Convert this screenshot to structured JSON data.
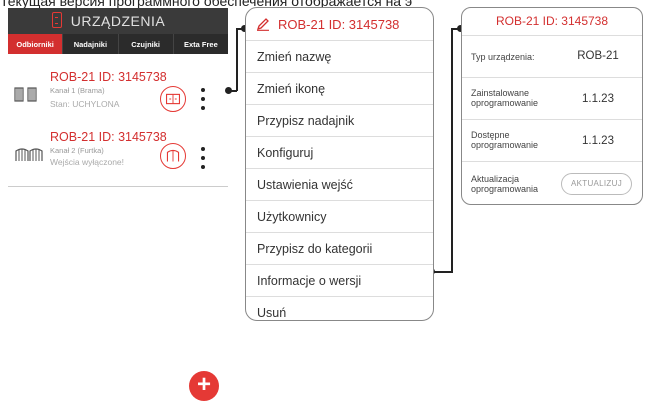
{
  "caption": "Текущая версия программного обеспечения отображается на э",
  "app": {
    "title": "URZĄDZENIA",
    "tabs": [
      "Odbiorniki",
      "Nadajniki",
      "Czujniki",
      "Exta Free"
    ],
    "devices": [
      {
        "title": "ROB-21 ID: 3145738",
        "channel": "Kanał 1 (Brama)",
        "status": "Stan: UCHYLONA",
        "icon": "sliding-gate-icon",
        "action_icon": "sliding-gate-round-icon"
      },
      {
        "title": "ROB-21 ID: 3145738",
        "channel": "Kanał 2 (Furtka)",
        "status": "Wejścia wyłączone!",
        "icon": "double-gate-icon",
        "action_icon": "double-gate-round-icon"
      }
    ],
    "fab_label": "+"
  },
  "menu": {
    "title": "ROB-21 ID: 3145738",
    "items": [
      "Zmień nazwę",
      "Zmień ikonę",
      "Przypisz nadajnik",
      "Konfiguruj",
      "Ustawienia wejść",
      "Użytkownicy",
      "Przypisz do kategorii",
      "Informacje o wersji",
      "Usuń"
    ]
  },
  "info": {
    "title": "ROB-21 ID: 3145738",
    "device_type_label": "Typ urządzenia:",
    "device_type_value": "ROB-21",
    "installed_label": "Zainstalowane oprogramowanie",
    "installed_value": "1.1.23",
    "available_label": "Dostępne oprogramowanie",
    "available_value": "1.1.23",
    "update_label": "Aktualizacja oprogramowania",
    "update_button": "AKTUALIZUJ"
  },
  "colors": {
    "accent": "#d32f2f",
    "header": "#3a3a3a",
    "tab_bar": "#2b2b2b"
  }
}
